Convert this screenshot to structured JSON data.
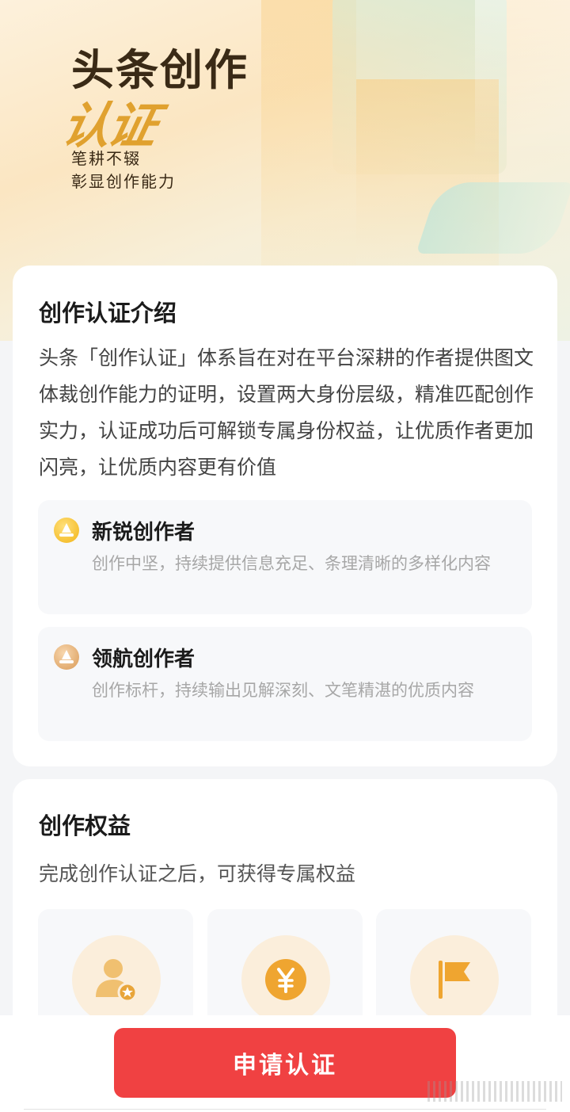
{
  "hero": {
    "title": "头条创作",
    "script_title": "认证",
    "tagline_line1": "笔耕不辍",
    "tagline_line2": "彰显创作能力"
  },
  "intro": {
    "title": "创作认证介绍",
    "description": "头条「创作认证」体系旨在对在平台深耕的作者提供图文体裁创作能力的证明，设置两大身份层级，精准匹配创作实力，认证成功后可解锁专属身份权益，让优质作者更加闪亮，让优质内容更有价值",
    "levels": [
      {
        "icon": "gold-sailboat-icon",
        "name": "新锐创作者",
        "description": "创作中坚，持续提供信息充足、条理清晰的多样化内容",
        "color": "#f2b417"
      },
      {
        "icon": "bronze-sailboat-icon",
        "name": "领航创作者",
        "description": "创作标杆，持续输出见解深刻、文笔精湛的优质内容",
        "color": "#d99a57"
      }
    ]
  },
  "rights": {
    "title": "创作权益",
    "subtitle": "完成创作认证之后，可获得专属权益",
    "benefits": [
      {
        "icon": "user-badge-icon"
      },
      {
        "icon": "yuan-coin-icon"
      },
      {
        "icon": "flag-icon"
      }
    ]
  },
  "footer": {
    "apply_label": "申请认证"
  },
  "colors": {
    "accent_red": "#f04142",
    "gold": "#e0a12f",
    "benefit_bg": "#fbeedb"
  }
}
